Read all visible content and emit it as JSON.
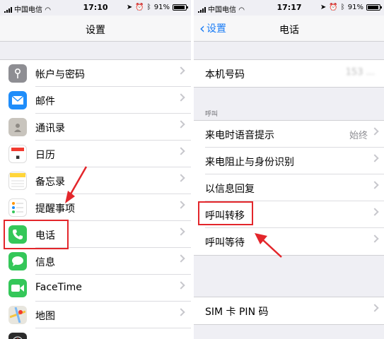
{
  "left": {
    "status": {
      "carrier": "中国电信",
      "time": "17:10",
      "battery": "91%"
    },
    "title": "设置",
    "items": [
      {
        "label": "帐户与密码",
        "icon": "key-icon",
        "color": "#8e8e93"
      },
      {
        "label": "邮件",
        "icon": "mail-icon",
        "color": "#1f8dfa"
      },
      {
        "label": "通讯录",
        "icon": "contacts-icon",
        "color": "#c8c4bd"
      },
      {
        "label": "日历",
        "icon": "calendar-icon",
        "color": "#ffffff"
      },
      {
        "label": "备忘录",
        "icon": "notes-icon",
        "color": "#ffd53a"
      },
      {
        "label": "提醒事项",
        "icon": "reminders-icon",
        "color": "#ffffff"
      },
      {
        "label": "电话",
        "icon": "phone-icon",
        "color": "#34c759"
      },
      {
        "label": "信息",
        "icon": "message-icon",
        "color": "#34c759"
      },
      {
        "label": "FaceTime",
        "icon": "facetime-icon",
        "color": "#34c759"
      },
      {
        "label": "地图",
        "icon": "maps-icon",
        "color": "#e8e6de"
      },
      {
        "label": "",
        "icon": "compass-icon",
        "color": "#2b2b2b"
      }
    ]
  },
  "right": {
    "status": {
      "carrier": "中国电信",
      "time": "17:17",
      "battery": "91%"
    },
    "back_label": "设置",
    "title": "电话",
    "my_number_label": "本机号码",
    "my_number_value": "153 ...",
    "section_header": "呼叫",
    "call_items": [
      {
        "label": "来电时语音提示",
        "value": "始终"
      },
      {
        "label": "来电阻止与身份识别",
        "value": ""
      },
      {
        "label": "以信息回复",
        "value": ""
      },
      {
        "label": "呼叫转移",
        "value": ""
      },
      {
        "label": "呼叫等待",
        "value": ""
      }
    ],
    "sim_label": "SIM 卡 PIN 码"
  },
  "colors": {
    "accent": "#1a7cf5",
    "highlight": "#e3262b"
  }
}
